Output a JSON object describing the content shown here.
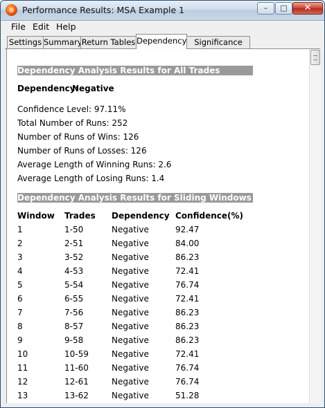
{
  "window": {
    "title": "Performance Results: MSA Example 1",
    "minimize_glyph": "–",
    "maximize_glyph": "□",
    "close_glyph": "✕"
  },
  "menu": {
    "items": [
      "File",
      "Edit",
      "Help"
    ]
  },
  "tabs": {
    "items": [
      "Settings",
      "Summary",
      "Return Tables",
      "Dependency",
      "Significance Test"
    ],
    "active": "Dependency"
  },
  "summary_section": {
    "heading": "Dependency Analysis Results for All Trades",
    "dependency_label": "Dependency:",
    "dependency_value": "Negative",
    "stats": [
      "Confidence Level: 97.11%",
      "Total Number of Runs: 252",
      "Number of Runs of Wins: 126",
      "Number of Runs of Losses: 126",
      "Average Length of Winning Runs: 2.6",
      "Average Length of Losing Runs: 1.4"
    ]
  },
  "sliding_section": {
    "heading": "Dependency Analysis Results for Sliding Windows",
    "columns": [
      "Window",
      "Trades",
      "Dependency",
      "Confidence(%)"
    ],
    "rows": [
      [
        "1",
        "1-50",
        "Negative",
        "92.47"
      ],
      [
        "2",
        "2-51",
        "Negative",
        "84.00"
      ],
      [
        "3",
        "3-52",
        "Negative",
        "86.23"
      ],
      [
        "4",
        "4-53",
        "Negative",
        "72.41"
      ],
      [
        "5",
        "5-54",
        "Negative",
        "76.74"
      ],
      [
        "6",
        "6-55",
        "Negative",
        "72.41"
      ],
      [
        "7",
        "7-56",
        "Negative",
        "86.23"
      ],
      [
        "8",
        "8-57",
        "Negative",
        "86.23"
      ],
      [
        "9",
        "9-58",
        "Negative",
        "86.23"
      ],
      [
        "10",
        "10-59",
        "Negative",
        "72.41"
      ],
      [
        "11",
        "11-60",
        "Negative",
        "76.74"
      ],
      [
        "12",
        "12-61",
        "Negative",
        "76.74"
      ],
      [
        "13",
        "13-62",
        "Negative",
        "51.28"
      ]
    ]
  },
  "scrollbar": {
    "up_glyph": "▲"
  }
}
